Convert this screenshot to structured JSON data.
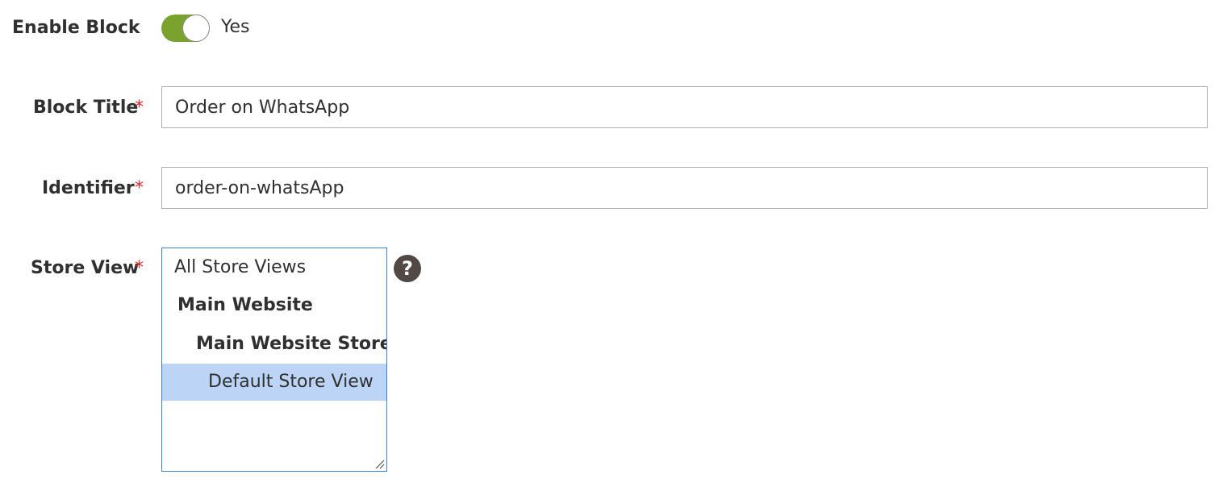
{
  "enable_block": {
    "label": "Enable Block",
    "value_text": "Yes",
    "enabled": true,
    "on_color": "#79a22e"
  },
  "block_title": {
    "label": "Block Title",
    "required_mark": "*",
    "value": "Order on WhatsApp"
  },
  "identifier": {
    "label": "Identifier",
    "required_mark": "*",
    "value": "order-on-whatsApp"
  },
  "store_view": {
    "label": "Store View",
    "required_mark": "*",
    "options": [
      {
        "label": "All Store Views",
        "level": 0,
        "group": false,
        "selected": false
      },
      {
        "label": "Main Website",
        "level": 1,
        "group": true,
        "selected": false
      },
      {
        "label": "Main Website Store",
        "level": 2,
        "group": true,
        "selected": false
      },
      {
        "label": "Default Store View",
        "level": 3,
        "group": false,
        "selected": true
      }
    ],
    "help_icon": "question-mark-icon",
    "help_glyph": "?",
    "selected_color": "#bcd5f7"
  },
  "colors": {
    "required": "#e22626",
    "focus_border": "#3e7ecf",
    "help_bg": "#514943"
  }
}
